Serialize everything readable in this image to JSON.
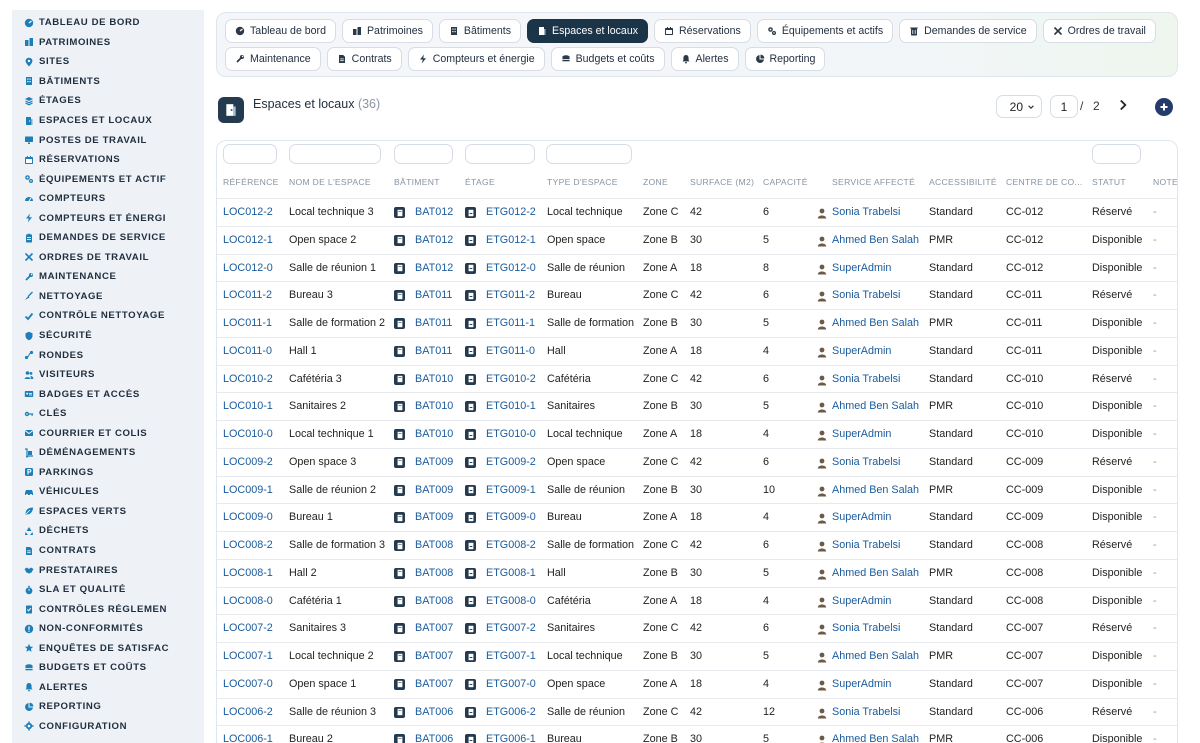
{
  "sidebar": {
    "items": [
      {
        "label": "TABLEAU DE BORD",
        "icon": "dashboard-icon"
      },
      {
        "label": "PATRIMOINES",
        "icon": "building-group-icon"
      },
      {
        "label": "SITES",
        "icon": "map-pin-icon"
      },
      {
        "label": "BÂTIMENTS",
        "icon": "building-icon"
      },
      {
        "label": "ÉTAGES",
        "icon": "layers-icon"
      },
      {
        "label": "ESPACES ET LOCAUX",
        "icon": "door-icon"
      },
      {
        "label": "POSTES DE TRAVAIL",
        "icon": "monitor-icon"
      },
      {
        "label": "RÉSERVATIONS",
        "icon": "calendar-icon"
      },
      {
        "label": "ÉQUIPEMENTS ET ACTIF",
        "icon": "gears-icon"
      },
      {
        "label": "COMPTEURS",
        "icon": "gauge-icon"
      },
      {
        "label": "COMPTEURS ET ÉNERGI",
        "icon": "bolt-icon"
      },
      {
        "label": "DEMANDES DE SERVICE",
        "icon": "clipboard-icon"
      },
      {
        "label": "ORDRES DE TRAVAIL",
        "icon": "tools-icon"
      },
      {
        "label": "MAINTENANCE",
        "icon": "wrench-icon"
      },
      {
        "label": "NETTOYAGE",
        "icon": "broom-icon"
      },
      {
        "label": "CONTRÔLE NETTOYAGE",
        "icon": "check-icon"
      },
      {
        "label": "SÉCURITÉ",
        "icon": "shield-icon"
      },
      {
        "label": "RONDES",
        "icon": "route-icon"
      },
      {
        "label": "VISITEURS",
        "icon": "users-icon"
      },
      {
        "label": "BADGES ET ACCÈS",
        "icon": "id-card-icon"
      },
      {
        "label": "CLÉS",
        "icon": "key-icon"
      },
      {
        "label": "COURRIER ET COLIS",
        "icon": "mail-icon"
      },
      {
        "label": "DÉMÉNAGEMENTS",
        "icon": "dolly-icon"
      },
      {
        "label": "PARKINGS",
        "icon": "parking-icon"
      },
      {
        "label": "VÉHICULES",
        "icon": "car-icon"
      },
      {
        "label": "ESPACES VERTS",
        "icon": "leaf-icon"
      },
      {
        "label": "DÉCHETS",
        "icon": "recycle-icon"
      },
      {
        "label": "CONTRATS",
        "icon": "document-icon"
      },
      {
        "label": "PRESTATAIRES",
        "icon": "handshake-icon"
      },
      {
        "label": "SLA ET QUALITÉ",
        "icon": "stopwatch-icon"
      },
      {
        "label": "CONTRÔLES RÉGLEMEN",
        "icon": "clipboard-check-icon"
      },
      {
        "label": "NON-CONFORMITÉS",
        "icon": "warning-icon"
      },
      {
        "label": "ENQUÊTES DE SATISFAC",
        "icon": "star-icon"
      },
      {
        "label": "BUDGETS ET COÛTS",
        "icon": "coins-icon"
      },
      {
        "label": "ALERTES",
        "icon": "bell-icon"
      },
      {
        "label": "REPORTING",
        "icon": "chart-pie-icon"
      },
      {
        "label": "CONFIGURATION",
        "icon": "gear-icon"
      }
    ]
  },
  "tabs": {
    "row1": [
      {
        "label": "Tableau de bord",
        "icon": "dashboard-icon"
      },
      {
        "label": "Patrimoines",
        "icon": "building-group-icon"
      },
      {
        "label": "Bâtiments",
        "icon": "building-icon"
      },
      {
        "label": "Espaces et locaux",
        "icon": "door-icon",
        "active": true
      },
      {
        "label": "Réservations",
        "icon": "calendar-icon"
      },
      {
        "label": "Équipements et actifs",
        "icon": "gears-icon"
      },
      {
        "label": "Demandes de service",
        "icon": "trash-icon"
      },
      {
        "label": "Ordres de travail",
        "icon": "tools-icon"
      }
    ],
    "row2": [
      {
        "label": "Maintenance",
        "icon": "wrench-icon"
      },
      {
        "label": "Contrats",
        "icon": "document-icon"
      },
      {
        "label": "Compteurs et énergie",
        "icon": "bolt-icon"
      },
      {
        "label": "Budgets et coûts",
        "icon": "coins-icon"
      },
      {
        "label": "Alertes",
        "icon": "bell-icon"
      },
      {
        "label": "Reporting",
        "icon": "chart-pie-icon"
      }
    ]
  },
  "header": {
    "title": "Espaces et locaux",
    "count": "(36)",
    "page_size": "20",
    "current_page": "1",
    "page_sep": "/",
    "total_pages": "2"
  },
  "columns": [
    "RÉFÉRENCE",
    "NOM DE L'ESPACE",
    "BÂTIMENT",
    "ÉTAGE",
    "TYPE D'ESPACE",
    "ZONE",
    "SURFACE (M2)",
    "CAPACITÉ",
    "SERVICE AFFECTÉ",
    "ACCESSIBILITÉ",
    "CENTRE DE CO...",
    "STATUT",
    "NOTE"
  ],
  "rows": [
    [
      "LOC012-2",
      "Local technique 3",
      "BAT012",
      "ETG012-2",
      "Local technique",
      "Zone C",
      "42",
      "6",
      "Sonia Trabelsi",
      "Standard",
      "CC-012",
      "Réservé",
      "-"
    ],
    [
      "LOC012-1",
      "Open space 2",
      "BAT012",
      "ETG012-1",
      "Open space",
      "Zone B",
      "30",
      "5",
      "Ahmed Ben Salah",
      "PMR",
      "CC-012",
      "Disponible",
      "-"
    ],
    [
      "LOC012-0",
      "Salle de réunion 1",
      "BAT012",
      "ETG012-0",
      "Salle de réunion",
      "Zone A",
      "18",
      "8",
      "SuperAdmin",
      "Standard",
      "CC-012",
      "Disponible",
      "-"
    ],
    [
      "LOC011-2",
      "Bureau 3",
      "BAT011",
      "ETG011-2",
      "Bureau",
      "Zone C",
      "42",
      "6",
      "Sonia Trabelsi",
      "Standard",
      "CC-011",
      "Réservé",
      "-"
    ],
    [
      "LOC011-1",
      "Salle de formation 2",
      "BAT011",
      "ETG011-1",
      "Salle de formation",
      "Zone B",
      "30",
      "5",
      "Ahmed Ben Salah",
      "PMR",
      "CC-011",
      "Disponible",
      "-"
    ],
    [
      "LOC011-0",
      "Hall 1",
      "BAT011",
      "ETG011-0",
      "Hall",
      "Zone A",
      "18",
      "4",
      "SuperAdmin",
      "Standard",
      "CC-011",
      "Disponible",
      "-"
    ],
    [
      "LOC010-2",
      "Cafétéria 3",
      "BAT010",
      "ETG010-2",
      "Cafétéria",
      "Zone C",
      "42",
      "6",
      "Sonia Trabelsi",
      "Standard",
      "CC-010",
      "Réservé",
      "-"
    ],
    [
      "LOC010-1",
      "Sanitaires 2",
      "BAT010",
      "ETG010-1",
      "Sanitaires",
      "Zone B",
      "30",
      "5",
      "Ahmed Ben Salah",
      "PMR",
      "CC-010",
      "Disponible",
      "-"
    ],
    [
      "LOC010-0",
      "Local technique 1",
      "BAT010",
      "ETG010-0",
      "Local technique",
      "Zone A",
      "18",
      "4",
      "SuperAdmin",
      "Standard",
      "CC-010",
      "Disponible",
      "-"
    ],
    [
      "LOC009-2",
      "Open space 3",
      "BAT009",
      "ETG009-2",
      "Open space",
      "Zone C",
      "42",
      "6",
      "Sonia Trabelsi",
      "Standard",
      "CC-009",
      "Réservé",
      "-"
    ],
    [
      "LOC009-1",
      "Salle de réunion 2",
      "BAT009",
      "ETG009-1",
      "Salle de réunion",
      "Zone B",
      "30",
      "10",
      "Ahmed Ben Salah",
      "PMR",
      "CC-009",
      "Disponible",
      "-"
    ],
    [
      "LOC009-0",
      "Bureau 1",
      "BAT009",
      "ETG009-0",
      "Bureau",
      "Zone A",
      "18",
      "4",
      "SuperAdmin",
      "Standard",
      "CC-009",
      "Disponible",
      "-"
    ],
    [
      "LOC008-2",
      "Salle de formation 3",
      "BAT008",
      "ETG008-2",
      "Salle de formation",
      "Zone C",
      "42",
      "6",
      "Sonia Trabelsi",
      "Standard",
      "CC-008",
      "Réservé",
      "-"
    ],
    [
      "LOC008-1",
      "Hall 2",
      "BAT008",
      "ETG008-1",
      "Hall",
      "Zone B",
      "30",
      "5",
      "Ahmed Ben Salah",
      "PMR",
      "CC-008",
      "Disponible",
      "-"
    ],
    [
      "LOC008-0",
      "Cafétéria 1",
      "BAT008",
      "ETG008-0",
      "Cafétéria",
      "Zone A",
      "18",
      "4",
      "SuperAdmin",
      "Standard",
      "CC-008",
      "Disponible",
      "-"
    ],
    [
      "LOC007-2",
      "Sanitaires 3",
      "BAT007",
      "ETG007-2",
      "Sanitaires",
      "Zone C",
      "42",
      "6",
      "Sonia Trabelsi",
      "Standard",
      "CC-007",
      "Réservé",
      "-"
    ],
    [
      "LOC007-1",
      "Local technique 2",
      "BAT007",
      "ETG007-1",
      "Local technique",
      "Zone B",
      "30",
      "5",
      "Ahmed Ben Salah",
      "PMR",
      "CC-007",
      "Disponible",
      "-"
    ],
    [
      "LOC007-0",
      "Open space 1",
      "BAT007",
      "ETG007-0",
      "Open space",
      "Zone A",
      "18",
      "4",
      "SuperAdmin",
      "Standard",
      "CC-007",
      "Disponible",
      "-"
    ],
    [
      "LOC006-2",
      "Salle de réunion 3",
      "BAT006",
      "ETG006-2",
      "Salle de réunion",
      "Zone C",
      "42",
      "12",
      "Sonia Trabelsi",
      "Standard",
      "CC-006",
      "Réservé",
      "-"
    ],
    [
      "LOC006-1",
      "Bureau 2",
      "BAT006",
      "ETG006-1",
      "Bureau",
      "Zone B",
      "30",
      "5",
      "Ahmed Ben Salah",
      "PMR",
      "CC-006",
      "Disponible",
      "-"
    ]
  ],
  "colors": {
    "accent": "#1c3448",
    "link": "#1a5b9c",
    "sidebar_bg": "#eef2f7",
    "icon": "#1e7fb8"
  }
}
